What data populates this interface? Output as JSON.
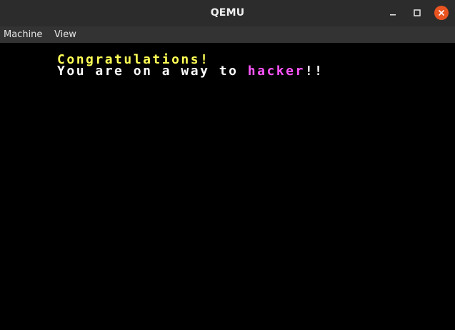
{
  "window": {
    "title": "QEMU"
  },
  "menubar": {
    "items": [
      {
        "label": "Machine"
      },
      {
        "label": "View"
      }
    ]
  },
  "console": {
    "lines": [
      {
        "segments": [
          {
            "text": "Congratulations!",
            "color": "#ffff55"
          }
        ]
      },
      {
        "segments": [
          {
            "text": "You are on a way to ",
            "color": "#ffffff"
          },
          {
            "text": "hacker",
            "color": "#ff55ff"
          },
          {
            "text": "!!",
            "color": "#ffffff"
          }
        ]
      }
    ]
  },
  "colors": {
    "titlebar_bg": "#2c2c2c",
    "menubar_bg": "#333333",
    "close_button": "#e95420",
    "screen_bg": "#000000"
  },
  "icons": {
    "minimize": "minimize-icon",
    "maximize": "maximize-icon",
    "close": "close-icon"
  }
}
